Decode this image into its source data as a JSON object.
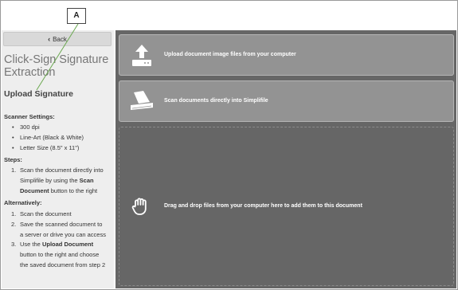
{
  "callout": {
    "label": "A"
  },
  "sidebar": {
    "back_label": "Back",
    "title": "Click-Sign Signature Extraction",
    "subtitle": "Upload Signature",
    "scanner_heading": "Scanner Settings:",
    "scanner_items": [
      "300 dpi",
      "Line-Art (Black & White)",
      "Letter Size (8.5\" x 11\")"
    ],
    "steps_heading": "Steps:",
    "step1": {
      "num": "1.",
      "line1": "Scan the document directly into",
      "line2": "Simplifile by using the",
      "bold": "Scan",
      "line3_bold": "Document",
      "line3": "button to the right"
    },
    "alt_heading": "Alternatively:",
    "alt1": {
      "num": "1.",
      "text": "Scan the document"
    },
    "alt2": {
      "num": "2.",
      "line1": "Save the scanned document to",
      "line2": "a server or drive you can access"
    },
    "alt3": {
      "num": "3.",
      "pre": "Use the",
      "bold": "Upload Document",
      "line2": "button to the right and choose",
      "line3": "the saved document from step 2"
    }
  },
  "main": {
    "upload_label": "Upload document image files from your computer",
    "scan_label": "Scan documents directly into Simplifile",
    "drop_label": "Drag and drop files from your computer here to add them to this document",
    "icons": {
      "upload": "upload-icon",
      "scan": "scanner-icon",
      "drop": "hand-icon"
    }
  }
}
